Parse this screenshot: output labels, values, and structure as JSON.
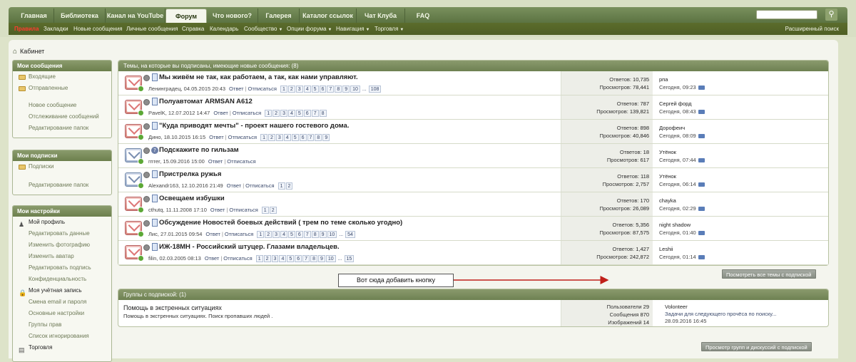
{
  "nav": {
    "tabs": [
      {
        "label": "Главная",
        "active": false
      },
      {
        "label": "Библиотека",
        "active": false
      },
      {
        "label": "Канал на YouTube",
        "active": false
      },
      {
        "label": "Форум",
        "active": true
      },
      {
        "label": "Что нового?",
        "active": false
      },
      {
        "label": "Галерея",
        "active": false
      },
      {
        "label": "Каталог ссылок",
        "active": false
      },
      {
        "label": "Чат Клуба",
        "active": false
      },
      {
        "label": "FAQ",
        "active": false
      }
    ],
    "search_placeholder": "",
    "search_icon": "search-icon"
  },
  "subnav": {
    "items": [
      {
        "label": "Правила",
        "highlight": true,
        "caret": false
      },
      {
        "label": "Закладки",
        "highlight": false,
        "caret": false
      },
      {
        "label": "Новые сообщения",
        "highlight": false,
        "caret": false
      },
      {
        "label": "Личные сообщения",
        "highlight": false,
        "caret": false
      },
      {
        "label": "Справка",
        "highlight": false,
        "caret": false
      },
      {
        "label": "Календарь",
        "highlight": false,
        "caret": false
      },
      {
        "label": "Сообщество",
        "highlight": false,
        "caret": true
      },
      {
        "label": "Опции форума",
        "highlight": false,
        "caret": true
      },
      {
        "label": "Навигация",
        "highlight": false,
        "caret": true
      },
      {
        "label": "Торговля",
        "highlight": false,
        "caret": true
      }
    ],
    "advanced_search": "Расширенный поиск"
  },
  "breadcrumb": {
    "label": "Кабинет"
  },
  "sidebar": {
    "messages": {
      "title": "Мои сообщения",
      "folders": [
        "Входящие",
        "Отправленные"
      ],
      "links": [
        "Новое сообщение",
        "Отслеживание сообщений",
        "Редактирование папок"
      ]
    },
    "subscriptions": {
      "title": "Мои подписки",
      "folders": [
        "Подписки"
      ],
      "links": [
        "Редактирование папок"
      ]
    },
    "settings": {
      "title": "Мои настройки",
      "profile_header": "Мой профиль",
      "profile_links": [
        "Редактировать данные",
        "Изменить фотографию",
        "Изменить аватар",
        "Редактировать подпись",
        "Конфиденциальность"
      ],
      "account_header": "Моя учётная запись",
      "account_links": [
        "Смена email и пароля",
        "Основные настройки",
        "Группы прав",
        "Список игнорирования"
      ],
      "trade_header": "Торговля"
    }
  },
  "threads": {
    "header": "Темы, на которые вы подписаны, имеющие новые сообщения: (8)",
    "replies_label": "Ответов:",
    "views_label": "Просмотров:",
    "reply_link": "Ответ",
    "unsubscribe_link": "Отписаться",
    "items": [
      {
        "title": "Мы живём не так, как работаем, а так, как нами управляют.",
        "meta": "Ленинградец, 04.05.2015 20:43",
        "pages": [
          "1",
          "2",
          "3",
          "4",
          "5",
          "6",
          "7",
          "8",
          "9",
          "10",
          "...",
          "108"
        ],
        "replies": "10,735",
        "views": "78,441",
        "last_user": "рпа",
        "last_date": "Сегодня, 09:23",
        "icon": "red",
        "type": "doc"
      },
      {
        "title": "Полуавтомат ARMSAN A612",
        "meta": "PavelK, 12.07.2012 14:47",
        "pages": [
          "1",
          "2",
          "3",
          "4",
          "5",
          "6",
          "7",
          "8"
        ],
        "replies": "787",
        "views": "139,821",
        "last_user": "Сергей форд",
        "last_date": "Сегодня, 08:43",
        "icon": "red",
        "type": "doc"
      },
      {
        "title": "\"Куда приводят мечты\" - проект нашего гостевого дома.",
        "meta": "Дино, 18.10.2015 16:15",
        "pages": [
          "1",
          "2",
          "3",
          "4",
          "5",
          "6",
          "7",
          "8",
          "9"
        ],
        "replies": "898",
        "views": "40,846",
        "last_user": "Дорофеич",
        "last_date": "Сегодня, 08:09",
        "icon": "red",
        "type": "doc"
      },
      {
        "title": "Подскажите по гильзам",
        "meta": "rrrrer, 15.09.2016 15:00",
        "pages": [],
        "replies": "18",
        "views": "617",
        "last_user": "Утёнок",
        "last_date": "Сегодня, 07:44",
        "icon": "blue",
        "type": "question"
      },
      {
        "title": "Пристрелка ружья",
        "meta": "Alexandr163, 12.10.2016 21:49",
        "pages": [
          "1",
          "2"
        ],
        "replies": "118",
        "views": "2,757",
        "last_user": "Утёнок",
        "last_date": "Сегодня, 06:14",
        "icon": "blue",
        "type": "doc"
      },
      {
        "title": "Освещаем избушки",
        "meta": "cthutq, 11.11.2008 17:10",
        "pages": [
          "1",
          "2"
        ],
        "replies": "170",
        "views": "26,089",
        "last_user": "chayka",
        "last_date": "Сегодня, 02:29",
        "icon": "red",
        "type": "doc"
      },
      {
        "title": "Обсуждение Новостей боевых действий ( трем по теме сколько угодно)",
        "meta": "Лис, 27.01.2015 09:54",
        "pages": [
          "1",
          "2",
          "3",
          "4",
          "5",
          "6",
          "7",
          "8",
          "9",
          "10",
          "...",
          "54"
        ],
        "replies": "5,356",
        "views": "87,575",
        "last_user": "night shadow",
        "last_date": "Сегодня, 01:40",
        "icon": "red",
        "type": "doc"
      },
      {
        "title": "ИЖ-18МН - Российский штуцер. Глазами владельцев.",
        "meta": "filin, 02.03.2005 08:13",
        "pages": [
          "1",
          "2",
          "3",
          "4",
          "5",
          "6",
          "7",
          "8",
          "9",
          "10",
          "...",
          "15"
        ],
        "replies": "1,427",
        "views": "242,872",
        "last_user": "Leshii",
        "last_date": "Сегодня, 01:14",
        "icon": "red",
        "type": "doc"
      }
    ],
    "view_all_button": "Посмотреть все темы с подпиской"
  },
  "callout": {
    "text": "Вот сюда добавить кнопку"
  },
  "groups": {
    "header": "Группы с подпиской: (1)",
    "title": "Помощь в экстренных ситуациях",
    "description": "Помощь в экстренных ситуациях. Поиск пропавших людей .",
    "members_label": "Пользователи",
    "members": "29",
    "messages_label": "Сообщения",
    "messages": "870",
    "images_label": "Изображений",
    "images": "14",
    "last_user": "Volonteer",
    "last_topic": "Задачи для следующего прочёса по поиску...",
    "last_date": "28.09.2016 16:45",
    "view_button": "Просмотр групп и дискуссий с подпиской"
  },
  "colors": {
    "nav_green": "#6b8250",
    "subnav_green": "#55662a",
    "rules_red": "#ff3b30",
    "panel_head": "#7d8f60",
    "callout_arrow": "#c0201a"
  }
}
